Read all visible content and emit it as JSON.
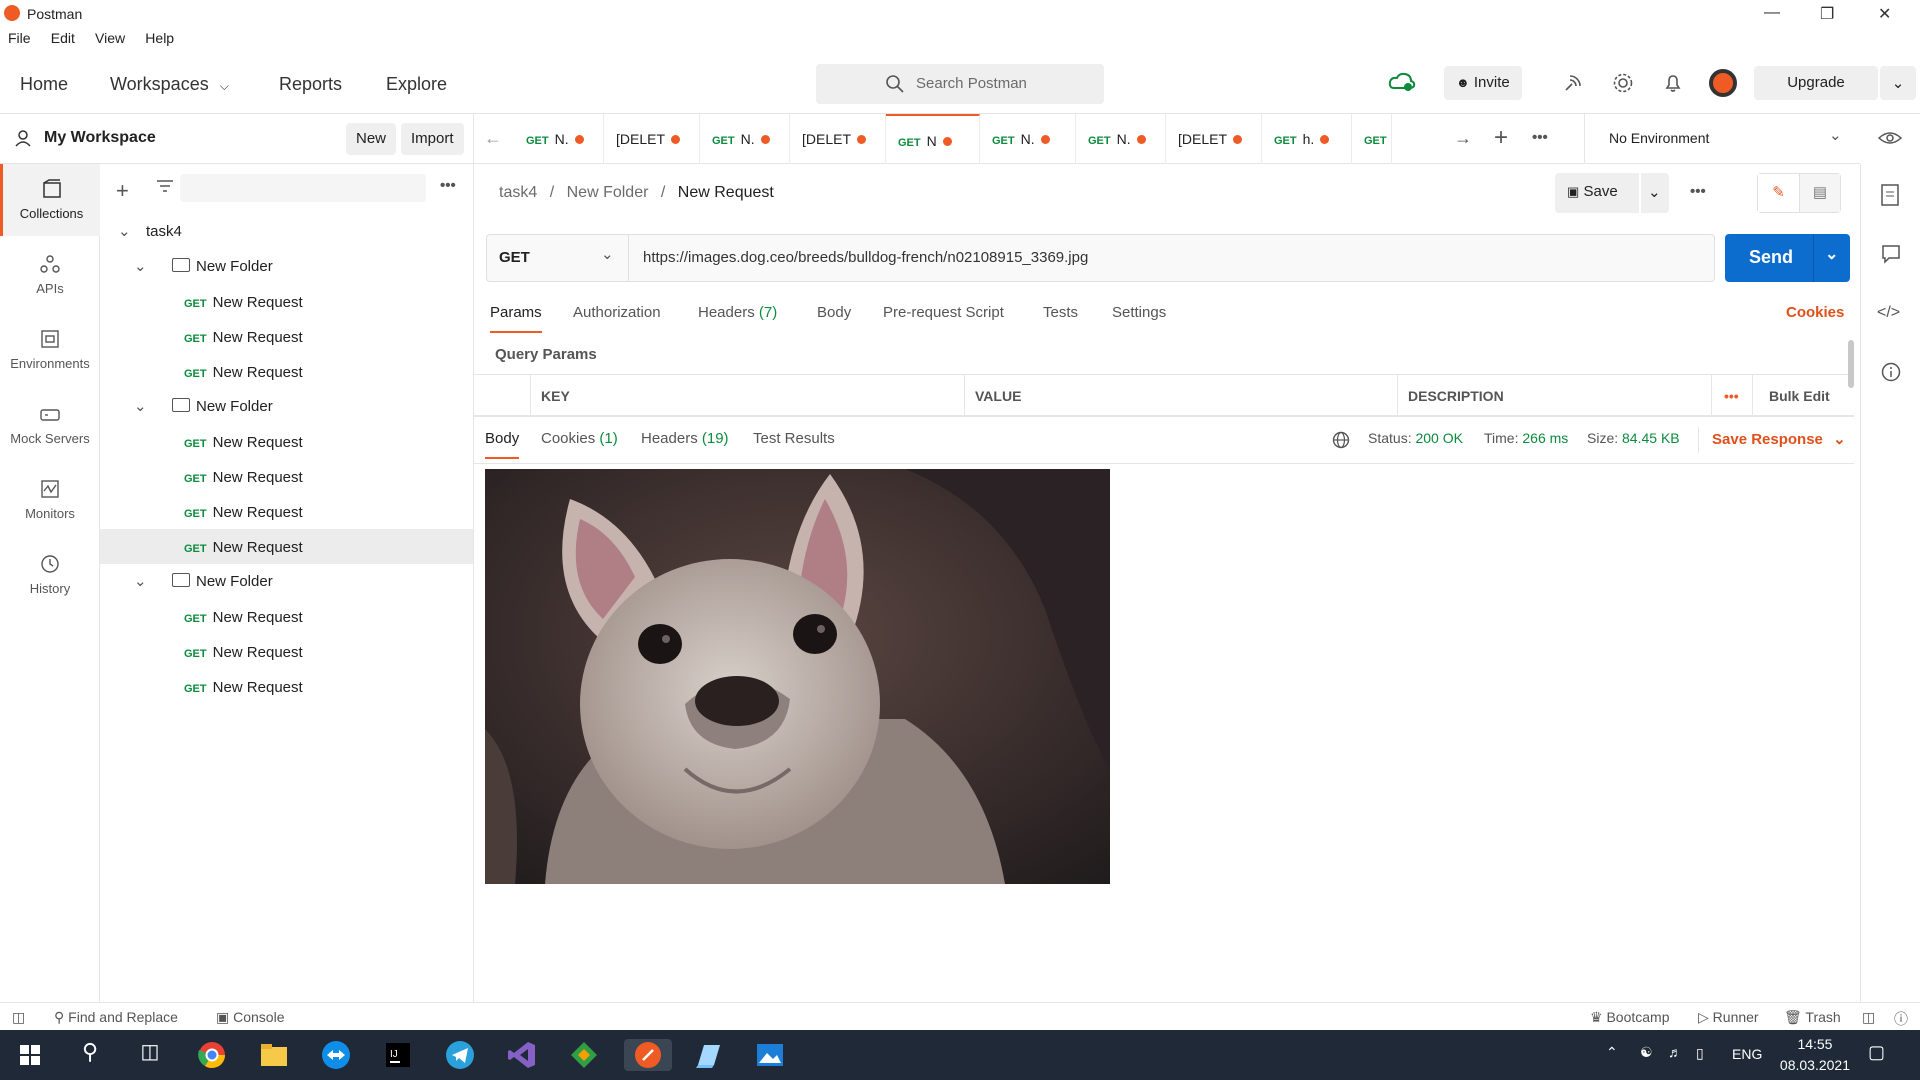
{
  "window": {
    "title": "Postman"
  },
  "menu": [
    "File",
    "Edit",
    "View",
    "Help"
  ],
  "header": {
    "nav": [
      "Home",
      "Workspaces",
      "Reports",
      "Explore"
    ],
    "search_placeholder": "Search Postman",
    "invite": "Invite",
    "upgrade": "Upgrade"
  },
  "workspace": {
    "name": "My Workspace",
    "new_label": "New",
    "import_label": "Import"
  },
  "rail": [
    "Collections",
    "APIs",
    "Environments",
    "Mock Servers",
    "Monitors",
    "History"
  ],
  "tree": {
    "collection": "task4",
    "folders": [
      {
        "name": "New Folder",
        "requests": [
          "New Request",
          "New Request",
          "New Request"
        ]
      },
      {
        "name": "New Folder",
        "requests": [
          "New Request",
          "New Request",
          "New Request",
          "New Request"
        ]
      },
      {
        "name": "New Folder",
        "requests": [
          "New Request",
          "New Request",
          "New Request"
        ]
      }
    ],
    "method": "GET"
  },
  "tabs": [
    {
      "method": "GET",
      "label": "N."
    },
    {
      "method": "",
      "label": "[DELET"
    },
    {
      "method": "GET",
      "label": "N."
    },
    {
      "method": "",
      "label": "[DELET"
    },
    {
      "method": "GET",
      "label": "N"
    },
    {
      "method": "GET",
      "label": "N."
    },
    {
      "method": "GET",
      "label": "N."
    },
    {
      "method": "",
      "label": "[DELET"
    },
    {
      "method": "GET",
      "label": "h."
    },
    {
      "method": "GET",
      "label": ""
    }
  ],
  "environment": "No Environment",
  "breadcrumb": {
    "a": "task4",
    "b": "New Folder",
    "c": "New Request",
    "sep": "/"
  },
  "save_label": "Save",
  "request": {
    "method": "GET",
    "url": "https://images.dog.ceo/breeds/bulldog-french/n02108915_3369.jpg",
    "send": "Send"
  },
  "request_tabs": {
    "params": "Params",
    "authorization": "Authorization",
    "headers": "Headers",
    "headers_count": "(7)",
    "body": "Body",
    "prerequest": "Pre-request Script",
    "tests": "Tests",
    "settings": "Settings",
    "cookies": "Cookies"
  },
  "query_params": {
    "title": "Query Params",
    "columns": [
      "KEY",
      "VALUE",
      "DESCRIPTION"
    ],
    "bulk_edit": "Bulk Edit"
  },
  "response": {
    "tabs": {
      "body": "Body",
      "cookies": "Cookies",
      "cookies_count": "(1)",
      "headers": "Headers",
      "headers_count": "(19)",
      "tests": "Test Results"
    },
    "status_label": "Status:",
    "status": "200 OK",
    "time_label": "Time:",
    "time": "266 ms",
    "size_label": "Size:",
    "size": "84.45 KB",
    "save": "Save Response"
  },
  "statusbar": {
    "find": "Find and Replace",
    "console": "Console",
    "bootcamp": "Bootcamp",
    "runner": "Runner",
    "trash": "Trash"
  },
  "taskbar": {
    "lang": "ENG",
    "time": "14:55",
    "date": "08.03.2021"
  }
}
